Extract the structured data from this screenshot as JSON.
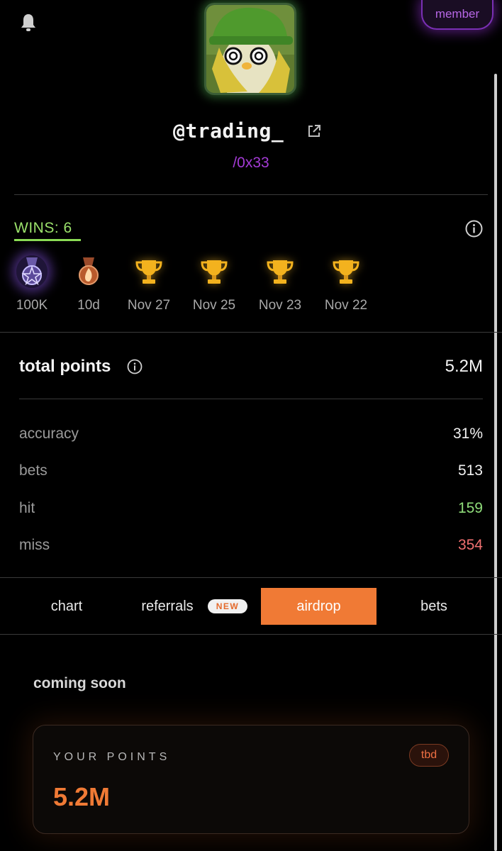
{
  "header": {
    "member_label": "member",
    "username": "@trading_",
    "handle": "/0x33"
  },
  "wins": {
    "label": "WINS: 6",
    "badges": [
      {
        "icon": "pentagram-medal-icon",
        "label": "100K"
      },
      {
        "icon": "flame-medal-icon",
        "label": "10d"
      },
      {
        "icon": "trophy-icon",
        "label": "Nov 27"
      },
      {
        "icon": "trophy-icon",
        "label": "Nov 25"
      },
      {
        "icon": "trophy-icon",
        "label": "Nov 23"
      },
      {
        "icon": "trophy-icon",
        "label": "Nov 22"
      }
    ]
  },
  "points": {
    "label": "total points",
    "value": "5.2M"
  },
  "stats": [
    {
      "label": "accuracy",
      "value": "31%",
      "color": "#f2f2f2"
    },
    {
      "label": "bets",
      "value": "513",
      "color": "#f2f2f2"
    },
    {
      "label": "hit",
      "value": "159",
      "color": "#8fdc7a"
    },
    {
      "label": "miss",
      "value": "354",
      "color": "#f07070"
    }
  ],
  "tabs": [
    {
      "label": "chart",
      "active": false
    },
    {
      "label": "referrals",
      "active": false,
      "badge": "NEW"
    },
    {
      "label": "airdrop",
      "active": true
    },
    {
      "label": "bets",
      "active": false
    }
  ],
  "airdrop": {
    "heading": "coming soon",
    "card_label": "YOUR POINTS",
    "card_badge": "tbd",
    "card_value": "5.2M"
  },
  "colors": {
    "accent": "#f07a35",
    "member": "#a43bd6",
    "wins": "#9be26b"
  }
}
